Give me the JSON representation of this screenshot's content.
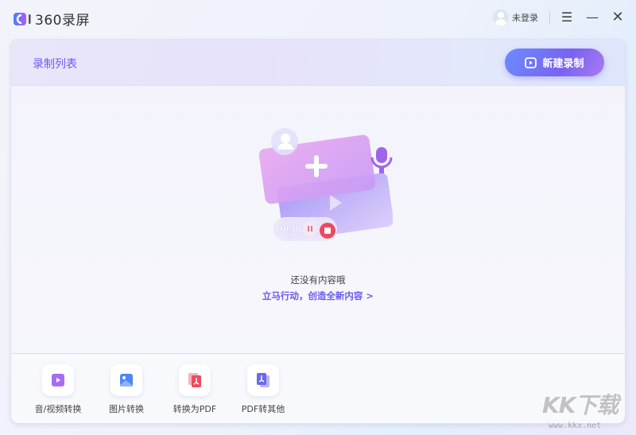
{
  "app": {
    "title": "360录屏"
  },
  "titlebar": {
    "user_label": "未登录",
    "menu_icon": "menu-icon",
    "minimize_icon": "minimize-icon",
    "close_icon": "close-icon"
  },
  "header": {
    "title": "录制列表",
    "new_button_label": "新建录制"
  },
  "empty": {
    "message": "还没有内容哦",
    "action": "立马行动，创造全新内容 >",
    "timer": "00:00"
  },
  "tools": [
    {
      "label": "音/视频转换",
      "icon": "video-convert-icon"
    },
    {
      "label": "图片转换",
      "icon": "image-convert-icon"
    },
    {
      "label": "转换为PDF",
      "icon": "to-pdf-icon"
    },
    {
      "label": "PDF转其他",
      "icon": "pdf-convert-icon"
    }
  ],
  "watermark": {
    "text": "KK下载",
    "url": "www.kkx.net"
  },
  "colors": {
    "accent": "#6a5cf0"
  }
}
